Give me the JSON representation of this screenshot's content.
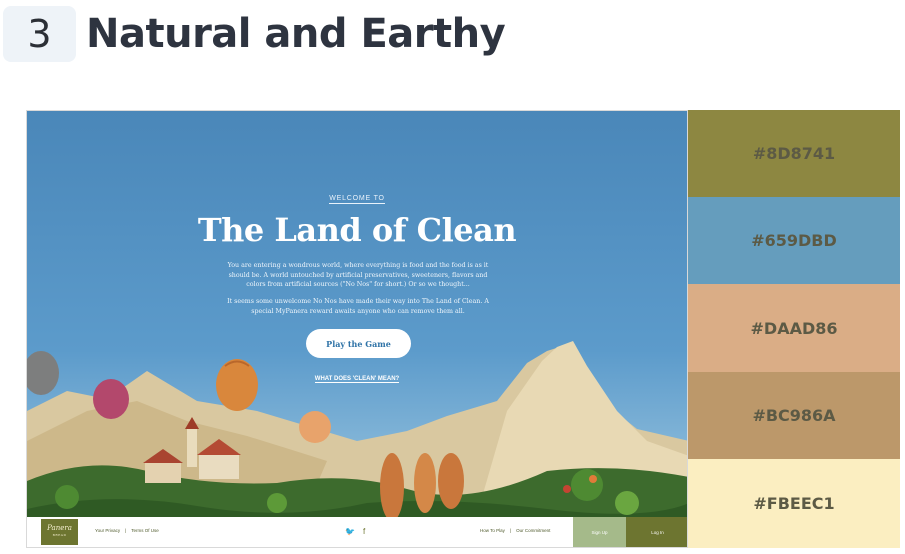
{
  "section": {
    "number": "3",
    "title": "Natural and Earthy"
  },
  "website": {
    "welcome": "WELCOME TO",
    "title": "The Land of Clean",
    "description": "You are entering a wondrous world, where everything is food and the food is as it should be. A world untouched by artificial preservatives, sweeteners, flavors and colors from artificial sources (\"No Nos\" for short.) Or so we thought...",
    "description2": "It seems some unwelcome No Nos have made their way into The Land of Clean. A special MyPanera reward awaits anyone who can remove them all.",
    "play_button": "Play the Game",
    "clean_link": "WHAT DOES 'CLEAN' MEAN?",
    "logo_text": "Panera",
    "logo_sub": "BREAD",
    "footer_privacy": "Your Privacy",
    "footer_sep": "|",
    "footer_terms": "Terms Of Use",
    "twitter_icon": "twitter-icon",
    "facebook_icon": "facebook-icon",
    "twitter_glyph": "🐦",
    "facebook_glyph": "f",
    "footer_howto": "How To Play",
    "footer_commitment": "Our Commitment",
    "signup": "Sign Up",
    "login": "Log In"
  },
  "swatches": [
    {
      "hex": "#8D8741",
      "color": "#8D8741"
    },
    {
      "hex": "#659DBD",
      "color": "#659DBD"
    },
    {
      "hex": "#DAAD86",
      "color": "#DAAD86"
    },
    {
      "hex": "#BC986A",
      "color": "#BC986A"
    },
    {
      "hex": "#FBEEC1",
      "color": "#FBEEC1"
    }
  ]
}
